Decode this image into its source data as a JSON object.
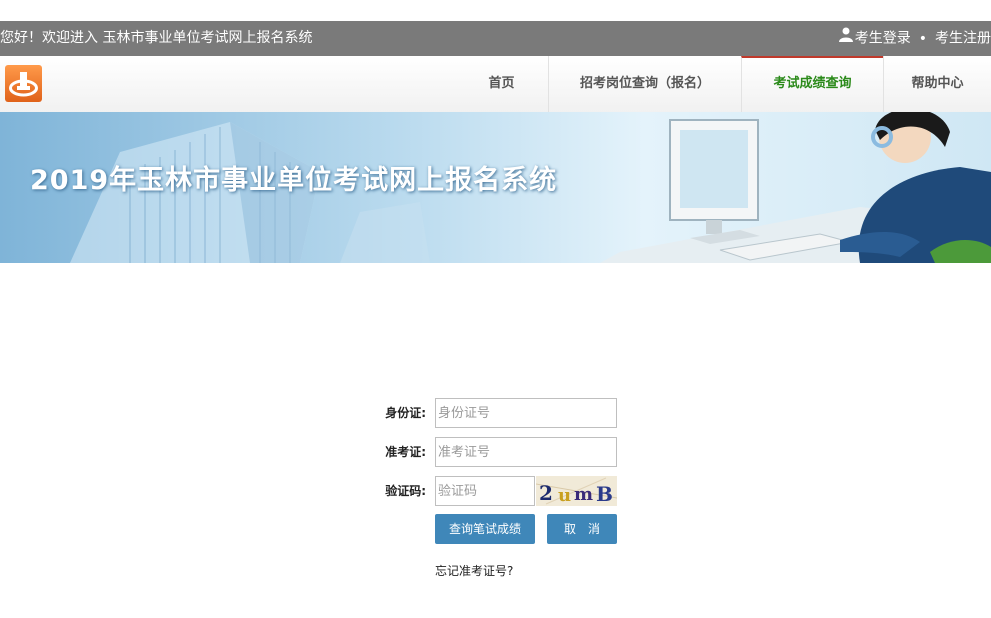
{
  "topbar": {
    "welcome": "您好！欢迎进入 玉林市事业单位考试网上报名系统",
    "login_label": "考生登录",
    "separator": "•",
    "register_label": "考生注册"
  },
  "nav": {
    "items": [
      {
        "label": "首页"
      },
      {
        "label": "招考岗位查询（报名）"
      },
      {
        "label": "考试成绩查询"
      },
      {
        "label": "帮助中心"
      }
    ]
  },
  "banner": {
    "title": "2019年玉林市事业单位考试网上报名系统"
  },
  "form": {
    "id_label": "身份证:",
    "id_placeholder": "身份证号",
    "ticket_label": "准考证:",
    "ticket_placeholder": "准考证号",
    "captcha_label": "验证码:",
    "captcha_placeholder": "验证码",
    "captcha_text": "2umB",
    "submit_label": "查询笔试成绩",
    "cancel_label": "取　消",
    "forgot_label": "忘记准考证号?"
  },
  "colors": {
    "topbar": "#7a7a7a",
    "nav_active": "#2b8a1a",
    "button": "#3f87b9",
    "logo": "#e8742a"
  }
}
